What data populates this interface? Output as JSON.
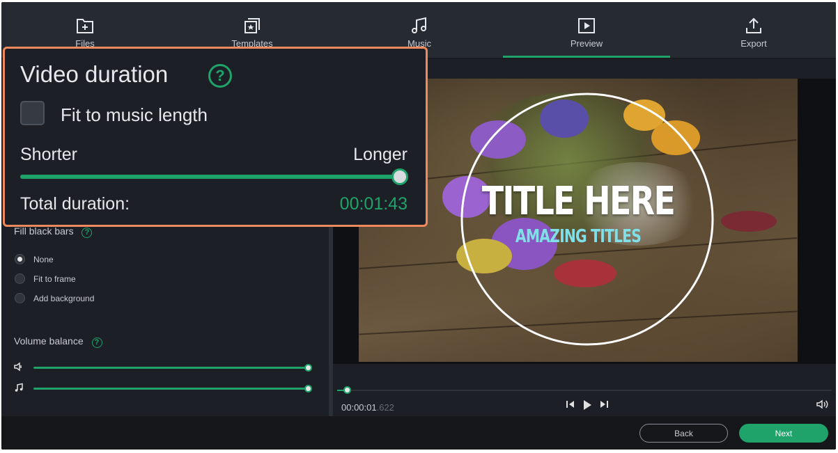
{
  "tabs": [
    {
      "label": "Files",
      "icon": "add-file-icon"
    },
    {
      "label": "Templates",
      "icon": "templates-icon"
    },
    {
      "label": "Music",
      "icon": "music-icon"
    },
    {
      "label": "Preview",
      "icon": "preview-icon",
      "active": true
    },
    {
      "label": "Export",
      "icon": "export-icon"
    }
  ],
  "settings": {
    "fill_black_bars_label": "Fill black bars",
    "fill_options": [
      {
        "label": "None",
        "selected": true
      },
      {
        "label": "Fit to frame",
        "selected": false
      },
      {
        "label": "Add background",
        "selected": false
      }
    ],
    "volume_balance_label": "Volume balance",
    "video_volume": 1.0,
    "music_volume": 1.0
  },
  "popup": {
    "title": "Video duration",
    "help": "?",
    "fit_label": "Fit to music length",
    "fit_checked": false,
    "shorter": "Shorter",
    "longer": "Longer",
    "duration_slider": 1.0,
    "total_label": "Total duration:",
    "total_value": "00:01:43"
  },
  "preview": {
    "title": "TITLE HERE",
    "subtitle": "AMAZING TITLES",
    "timecode_main": "00:00:01",
    "timecode_ms": ".622",
    "playhead": 0.02
  },
  "footer": {
    "back_label": "Back",
    "next_label": "Next"
  },
  "colors": {
    "accent": "#1fa36a",
    "highlight": "#f08a5d",
    "background": "#1c1f25"
  }
}
